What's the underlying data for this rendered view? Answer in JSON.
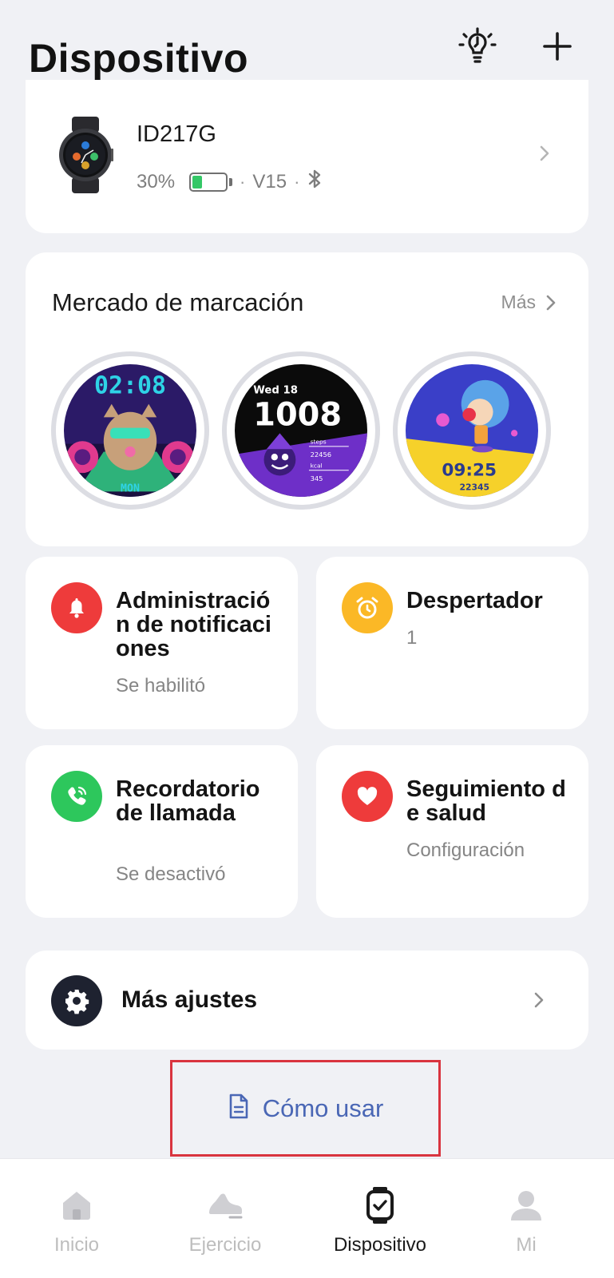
{
  "header": {
    "title": "Dispositivo",
    "tips_icon": "lightbulb-icon",
    "add_icon": "plus-icon"
  },
  "device": {
    "name": "ID217G",
    "battery_percent_label": "30%",
    "battery_level": 0.3,
    "firmware": "V15",
    "separator": "·",
    "bluetooth_icon": "bluetooth-icon"
  },
  "market": {
    "title": "Mercado de marcación",
    "more_label": "Más",
    "faces": [
      {
        "name": "watchface-1",
        "time_text": "02:08",
        "day_text": "MON"
      },
      {
        "name": "watchface-2",
        "date_text": "Wed 18",
        "time_text": "1008",
        "steps_label": "steps",
        "steps_value": "22456",
        "kcal_label": "kcal",
        "kcal_value": "345"
      },
      {
        "name": "watchface-3",
        "time_text": "09:25",
        "steps_value": "22345"
      }
    ]
  },
  "features": [
    {
      "title": "Administración de notificaciones",
      "sub": "Se habilitó",
      "icon": "bell-icon",
      "color": "#EE3B3B"
    },
    {
      "title": "Despertador",
      "sub": "1",
      "icon": "alarm-clock-icon",
      "color": "#FBB826"
    },
    {
      "title": "Recordatorio de llamada",
      "sub": "Se desactivó",
      "icon": "phone-icon",
      "color": "#2DC75C"
    },
    {
      "title": "Seguimiento de salud",
      "sub": "Configuración",
      "icon": "heart-icon",
      "color": "#EE3B3B"
    }
  ],
  "more_settings": {
    "label": "Más ajustes",
    "icon": "gear-icon"
  },
  "how_to_use": {
    "label": "Cómo usar",
    "icon": "document-icon"
  },
  "tabs": [
    {
      "label": "Inicio",
      "icon": "home-icon",
      "active": false
    },
    {
      "label": "Ejercicio",
      "icon": "running-shoe-icon",
      "active": false
    },
    {
      "label": "Dispositivo",
      "icon": "watch-icon",
      "active": true
    },
    {
      "label": "Mi",
      "icon": "person-icon",
      "active": false
    }
  ],
  "colors": {
    "background": "#F0F1F5",
    "accent_blue": "#4A67B5",
    "battery_green": "#34C766",
    "highlight_red": "#D9343F"
  }
}
